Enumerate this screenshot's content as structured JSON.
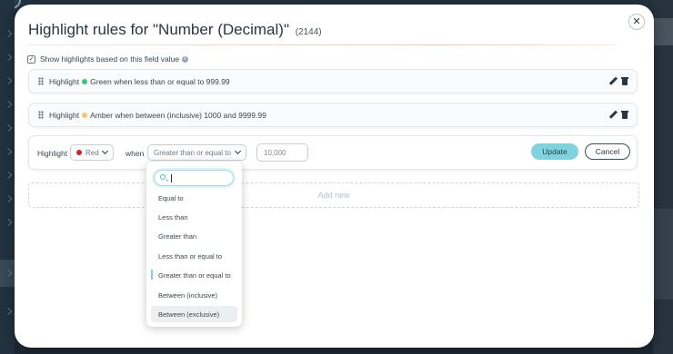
{
  "modal": {
    "title": "Highlight rules for \"Number (Decimal)\"",
    "count": "(2144)",
    "close_glyph": "✕",
    "show_highlights_label": "Show highlights based on this field value",
    "show_highlights_checked": true,
    "info_glyph": "i"
  },
  "rules": [
    {
      "prefix": "Highlight",
      "color_name": "green",
      "color": "#3cc47c",
      "text": "Green when less than or equal to 999.99"
    },
    {
      "prefix": "Highlight",
      "color_name": "amber",
      "color": "#f3c76e",
      "text": "Amber when between (inclusive) 1000 and 9999.99"
    }
  ],
  "editor": {
    "highlight_label": "Highlight",
    "color_value": "Red",
    "color": "#c62828",
    "when_label": "when",
    "operator_value": "Greater than or equal to",
    "value": "10,000",
    "update_label": "Update",
    "cancel_label": "Cancel"
  },
  "add_new_label": "Add new",
  "dropdown": {
    "search_value": "",
    "options": [
      "Equal to",
      "Less than",
      "Greater than",
      "Less than or equal to",
      "Greater than or equal to",
      "Between (inclusive)",
      "Between (exclusive)"
    ],
    "selected": "Greater than or equal to",
    "hovered": "Between (exclusive)"
  },
  "colors": {
    "accent": "#7fd3de",
    "backdrop": "#1c2a36"
  }
}
